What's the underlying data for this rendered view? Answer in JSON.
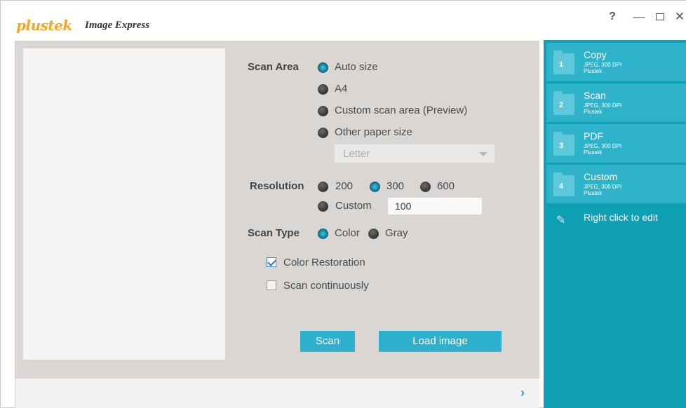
{
  "app": {
    "logo": "plustek",
    "name": "Image Express"
  },
  "window_controls": {
    "help": "?",
    "minimize": "—",
    "close": "✕"
  },
  "scan_area": {
    "label": "Scan Area",
    "options": [
      {
        "label": "Auto size",
        "selected": true
      },
      {
        "label": "A4",
        "selected": false
      },
      {
        "label": "Custom scan area (Preview)",
        "selected": false
      },
      {
        "label": "Other paper size",
        "selected": false
      }
    ],
    "paper_size_select": {
      "value": "Letter"
    }
  },
  "resolution": {
    "label": "Resolution",
    "options": [
      {
        "label": "200",
        "selected": false
      },
      {
        "label": "300",
        "selected": true
      },
      {
        "label": "600",
        "selected": false
      },
      {
        "label": "Custom",
        "selected": false
      }
    ],
    "custom_value": "100"
  },
  "scan_type": {
    "label": "Scan Type",
    "options": [
      {
        "label": "Color",
        "selected": true
      },
      {
        "label": "Gray",
        "selected": false
      }
    ]
  },
  "checkboxes": [
    {
      "label": "Color Restoration",
      "checked": true
    },
    {
      "label": "Scan continuously",
      "checked": false
    }
  ],
  "buttons": {
    "scan": "Scan",
    "load_image": "Load image"
  },
  "sidebar": {
    "items": [
      {
        "number": "1",
        "title": "Copy",
        "format": "JPEG, 300 DPI",
        "brand": "Plustek"
      },
      {
        "number": "2",
        "title": "Scan",
        "format": "JPEG, 300 DPI",
        "brand": "Plustek"
      },
      {
        "number": "3",
        "title": "PDF",
        "format": "JPEG, 300 DPI",
        "brand": "Plustek"
      },
      {
        "number": "4",
        "title": "Custom",
        "format": "JPEG, 300 DPI",
        "brand": "Plustek"
      }
    ],
    "hint": "Right click to edit",
    "hint_icon": "edit-icon"
  },
  "colors": {
    "accent": "#2fb0cc",
    "sidebar_bg": "#0f9fb5",
    "sidebar_item": "#2eb3cb",
    "logo": "#f5a623",
    "panel_bg": "#d9d6d3"
  }
}
